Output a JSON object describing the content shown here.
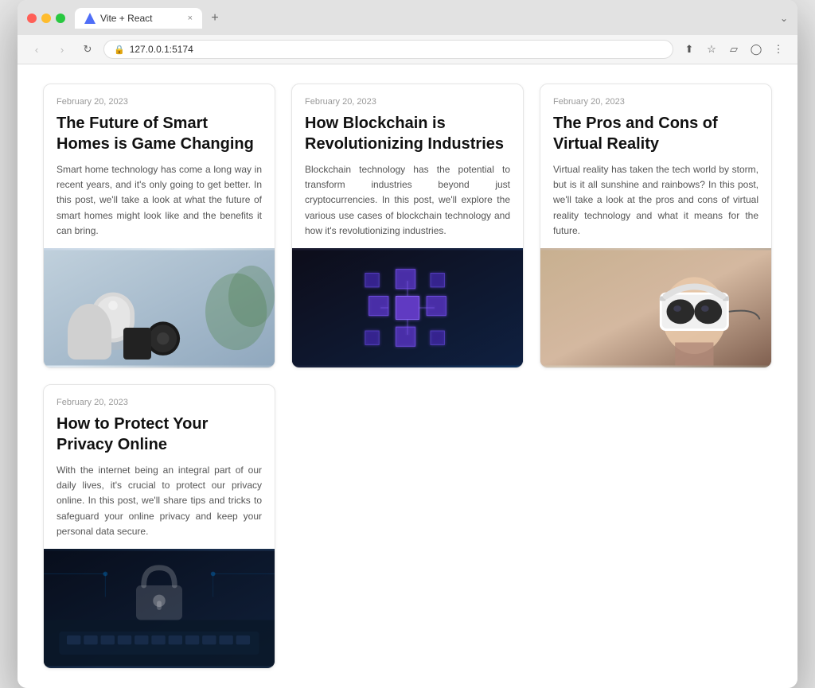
{
  "browser": {
    "tab_title": "Vite + React",
    "tab_close": "×",
    "new_tab": "+",
    "back": "‹",
    "forward": "›",
    "refresh": "↻",
    "address": "127.0.0.1:5174",
    "address_protocol": "127.0.0.1:5174",
    "share_icon": "⬆",
    "bookmark_icon": "☆",
    "sidebar_icon": "▱",
    "profile_icon": "◯",
    "more_icon": "⋮",
    "chevron_down": "⌄"
  },
  "cards": [
    {
      "date": "February 20, 2023",
      "title": "The Future of Smart Homes is Game Changing",
      "excerpt": "Smart home technology has come a long way in recent years, and it's only going to get better. In this post, we'll take a look at what the future of smart homes might look like and the benefits it can bring.",
      "image_type": "smarthome"
    },
    {
      "date": "February 20, 2023",
      "title": "How Blockchain is Revolutionizing Industries",
      "excerpt": "Blockchain technology has the potential to transform industries beyond just cryptocurrencies. In this post, we'll explore the various use cases of blockchain technology and how it's revolutionizing industries.",
      "image_type": "blockchain"
    },
    {
      "date": "February 20, 2023",
      "title": "The Pros and Cons of Virtual Reality",
      "excerpt": "Virtual reality has taken the tech world by storm, but is it all sunshine and rainbows? In this post, we'll take a look at the pros and cons of virtual reality technology and what it means for the future.",
      "image_type": "vr"
    }
  ],
  "bottom_cards": [
    {
      "date": "February 20, 2023",
      "title": "How to Protect Your Privacy Online",
      "excerpt": "With the internet being an integral part of our daily lives, it's crucial to protect our privacy online. In this post, we'll share tips and tricks to safeguard your online privacy and keep your personal data secure.",
      "image_type": "privacy"
    }
  ]
}
